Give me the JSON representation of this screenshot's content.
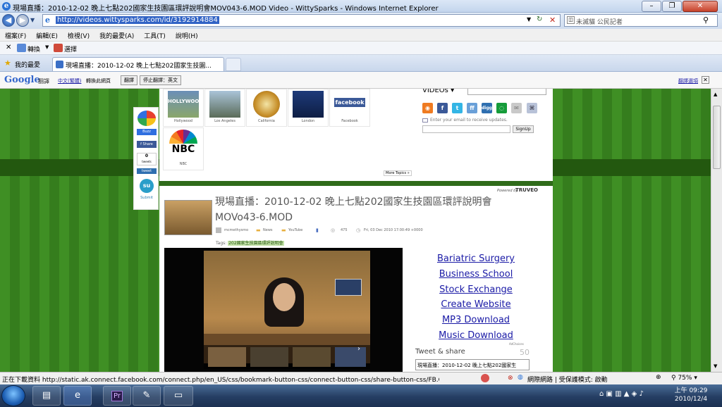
{
  "window": {
    "title": "現場直播：2010-12-02 晚上七點202國家生技園區環評說明會MOV043-6.MOD Video - WittySparks - Windows Internet Explorer"
  },
  "address_bar": {
    "url": "http://videos.wittysparks.com/id/3192914884",
    "search_placeholder": "未滅貓 公民記者"
  },
  "menu": [
    "檔案(F)",
    "編輯(E)",
    "檢視(V)",
    "我的最愛(A)",
    "工具(T)",
    "說明(H)"
  ],
  "toolbar": {
    "convert": "轉換",
    "select": "選擇"
  },
  "favorites": {
    "label": "我的最愛"
  },
  "tab": {
    "title": "現場直播：2010-12-02 晚上七點202國家生技園..."
  },
  "google_bar": {
    "logo": "Google",
    "translate": "翻譯",
    "from_lang": "中文(繁體)",
    "detected": "轉換此網頁",
    "translate_btn": "翻譯",
    "stop_btn": "停止翻譯：英文",
    "options": "翻譯選項"
  },
  "share_column": {
    "buzz": "Buzz",
    "fb_share": "Share",
    "tweet_count": "0",
    "tweets_label": "tweets",
    "tweet_btn": "tweet",
    "submit": "Submit"
  },
  "topics": {
    "tiles": [
      {
        "label": "Hollywood"
      },
      {
        "label": "Los Angeles"
      },
      {
        "label": "California"
      },
      {
        "label": "London"
      },
      {
        "label": "Facebook"
      }
    ],
    "nbc": {
      "logo": "NBC",
      "label": "NBC"
    },
    "more": "More Topics »"
  },
  "sidebar_top": {
    "videos_select": "VIDEOs",
    "email_placeholder": "Enter your email to receive updates.",
    "signup": "SignUp"
  },
  "article": {
    "powered": "Powered by",
    "truveo": "TRUVEO",
    "title": "現場直播：2010-12-02 晚上七點202國家生技園區環評說明會 MOVo43-6.MOD",
    "author": "mcmethysmo",
    "cat_news": "News",
    "cat_youtube": "YouTube",
    "views": "475",
    "date": "Fri, 03 Dec 2010 17:00:49 +0000",
    "tags_label": "Tags:",
    "tags_value": "202國家生技園區環評說明會"
  },
  "ad_links": [
    "Bariatric Surgery",
    "Business School",
    "Stock Exchange",
    "Create Website",
    "MP3 Download",
    "Music Download"
  ],
  "ad_choices": "AdChoices",
  "tweet_share": {
    "label": "Tweet & share",
    "count": "50",
    "box_text": "現場直播：2010-12-02 晚上七點202國家生"
  },
  "status_bar": {
    "text": "正在下載資料 http://static.ak.connect.facebook.com/connect.php/en_US/css/bookmark-button-css/connect-button-css/share-button-css/FB.Connec",
    "zone": "網際網路 | 受保護模式: 啟動",
    "zoom": "75%"
  },
  "taskbar": {
    "time": "上午 09:29",
    "date": "2010/12/4"
  }
}
